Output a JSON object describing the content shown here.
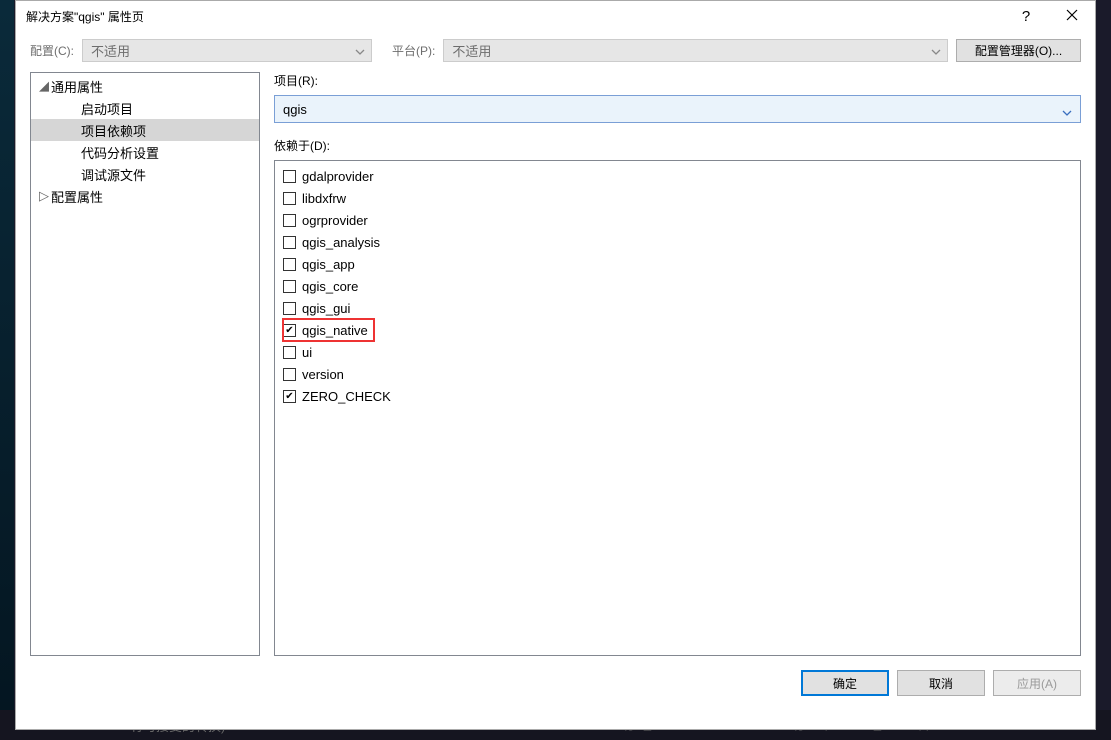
{
  "titlebar": {
    "title": "解决方案\"qgis\" 属性页"
  },
  "config_row": {
    "config_label": "配置(C):",
    "config_value": "不适用",
    "platform_label": "平台(P):",
    "platform_value": "不适用",
    "manager_btn": "配置管理器(O)..."
  },
  "tree": {
    "items": [
      {
        "label": "通用属性",
        "depth": 1,
        "expanded": true,
        "hasChildren": true
      },
      {
        "label": "启动项目",
        "depth": 2
      },
      {
        "label": "项目依赖项",
        "depth": 2,
        "selected": true
      },
      {
        "label": "代码分析设置",
        "depth": 2
      },
      {
        "label": "调试源文件",
        "depth": 2
      },
      {
        "label": "配置属性",
        "depth": 1,
        "expanded": false,
        "hasChildren": true
      }
    ]
  },
  "right": {
    "project_label": "项目(R):",
    "project_value": "qgis",
    "depends_label": "依赖于(D):",
    "depends_items": [
      {
        "label": "gdalprovider",
        "checked": false
      },
      {
        "label": "libdxfrw",
        "checked": false
      },
      {
        "label": "ogrprovider",
        "checked": false
      },
      {
        "label": "qgis_analysis",
        "checked": false
      },
      {
        "label": "qgis_app",
        "checked": false
      },
      {
        "label": "qgis_core",
        "checked": false
      },
      {
        "label": "qgis_gui",
        "checked": false
      },
      {
        "label": "qgis_native",
        "checked": true,
        "highlighted": true
      },
      {
        "label": "ui",
        "checked": false
      },
      {
        "label": "version",
        "checked": false
      },
      {
        "label": "ZERO_CHECK",
        "checked": true
      }
    ]
  },
  "footer": {
    "ok": "确定",
    "cancel": "取消",
    "apply": "应用(A)"
  },
  "behind": {
    "bottom_left": "有可接受的转换)",
    "bottom_mid": "qgis_core",
    "bottom_right": "qgsexpression_texts.cpp"
  }
}
